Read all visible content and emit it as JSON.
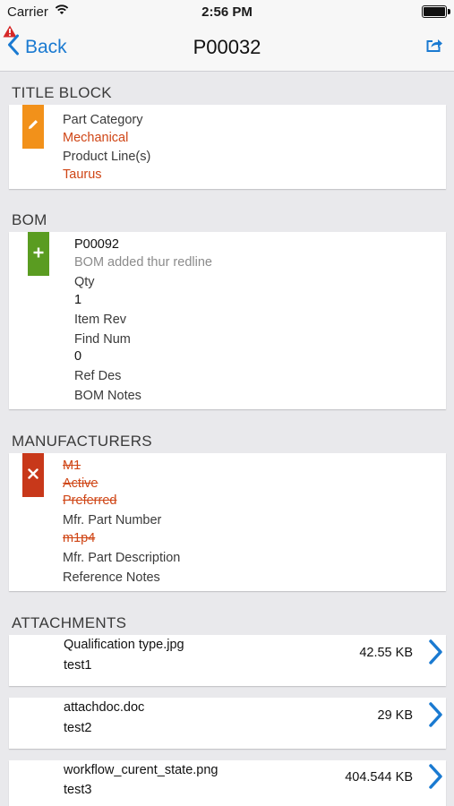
{
  "status": {
    "carrier": "Carrier",
    "time": "2:56 PM"
  },
  "nav": {
    "back_label": "Back",
    "title": "P00032"
  },
  "title_block": {
    "heading": "TITLE BLOCK",
    "part_category_label": "Part Category",
    "part_category_value": "Mechanical",
    "product_lines_label": "Product Line(s)",
    "product_lines_value": "Taurus"
  },
  "bom": {
    "heading": "BOM",
    "item_number": "P00092",
    "note": "BOM added thur redline",
    "qty_label": "Qty",
    "qty_value": "1",
    "item_rev_label": "Item Rev",
    "find_num_label": "Find Num",
    "find_num_value": "0",
    "ref_des_label": "Ref Des",
    "bom_notes_label": "BOM Notes"
  },
  "manufacturers": {
    "heading": "MANUFACTURERS",
    "name": "M1",
    "status": "Active",
    "preference": "Preferred",
    "mfr_part_number_label": "Mfr. Part Number",
    "mfr_part_number_value": "m1p4",
    "mfr_part_description_label": "Mfr. Part Description",
    "reference_notes_label": "Reference Notes"
  },
  "attachments": {
    "heading": "ATTACHMENTS",
    "items": [
      {
        "name": "Qualification type.jpg",
        "description": "test1",
        "size": "42.55 KB"
      },
      {
        "name": "attachdoc.doc",
        "description": "test2",
        "size": "29 KB"
      },
      {
        "name": "workflow_curent_state.png",
        "description": "test3",
        "size": "404.544 KB"
      }
    ]
  },
  "colors": {
    "accent": "#1a7ad1",
    "added": "#5a9c21",
    "modified": "#f2911a",
    "removed": "#c8381a"
  }
}
